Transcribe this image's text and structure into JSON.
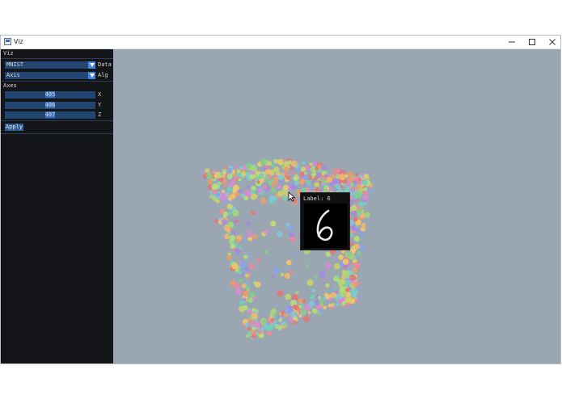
{
  "window": {
    "title": "Viz"
  },
  "sidebar": {
    "header": "Viz",
    "dataset_select": {
      "value": "MNIST",
      "label": "Data"
    },
    "algorithm_select": {
      "value": "Axis",
      "label": "Alg"
    },
    "axes_title": "Axes",
    "axes": [
      {
        "value": "405",
        "label": "X"
      },
      {
        "value": "406",
        "label": "Y"
      },
      {
        "value": "407",
        "label": "Z"
      }
    ],
    "apply_label": "Apply"
  },
  "tooltip": {
    "label": "Label: 6"
  },
  "colors": {
    "panel": "#141519",
    "field": "#234571",
    "accent": "#4385dc",
    "viewport": "#9aa6b1"
  }
}
